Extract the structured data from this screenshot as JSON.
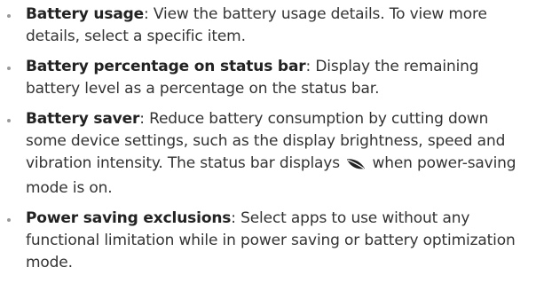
{
  "items": [
    {
      "term": "Battery usage",
      "sep": ": ",
      "desc": "View the battery usage details. To view more details, select a specific item."
    },
    {
      "term": "Battery percentage on status bar",
      "sep": ": ",
      "desc": "Display the remaining battery level as a percentage on the status bar."
    },
    {
      "term": "Battery saver",
      "sep": ": ",
      "desc_before_icon": "Reduce battery consumption by cutting down some device settings, such as the display brightness, speed and vibration intensity. The status bar displays",
      "icon": "leaf-icon",
      "desc_after_icon": "when power-saving mode is on."
    },
    {
      "term": "Power saving exclusions",
      "sep": ": ",
      "desc": "Select apps to use without any functional limitation while in power saving or battery optimization mode."
    }
  ]
}
